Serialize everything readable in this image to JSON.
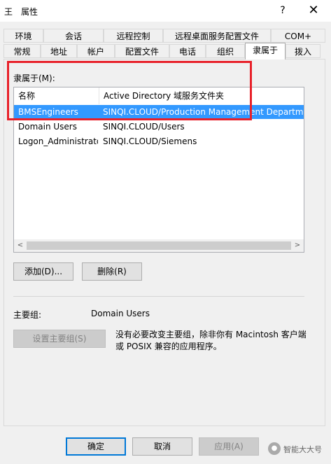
{
  "window": {
    "title": "王　属性",
    "help_glyph": "?",
    "close_glyph": "✕"
  },
  "tabs_row1": [
    "环境",
    "会话",
    "远程控制",
    "远程桌面服务配置文件",
    "COM+"
  ],
  "tabs_row2": [
    "常规",
    "地址",
    "帐户",
    "配置文件",
    "电话",
    "组织",
    "隶属于",
    "拨入"
  ],
  "member_of_label": "隶属于(M):",
  "list": {
    "headers": [
      "名称",
      "Active Directory 域服务文件夹"
    ],
    "rows": [
      {
        "name": "BMSEngineers",
        "folder": "SINQI.CLOUD/Production Management Department",
        "selected": true
      },
      {
        "name": "Domain Users",
        "folder": "SINQI.CLOUD/Users",
        "selected": false
      },
      {
        "name": "Logon_Administrators",
        "folder": "SINQI.CLOUD/Siemens",
        "selected": false
      }
    ]
  },
  "scroll": {
    "left": "<",
    "right": ">"
  },
  "buttons": {
    "add": "添加(D)...",
    "remove": "删除(R)"
  },
  "primary_group": {
    "label": "主要组:",
    "value": "Domain Users"
  },
  "set_primary_button": "设置主要组(S)",
  "note": "没有必要改变主要组，除非你有 Macintosh 客户端或 POSIX 兼容的应用程序。",
  "footer": {
    "ok": "确定",
    "cancel": "取消",
    "apply": "应用(A)"
  },
  "watermark": {
    "text": "智能大大号"
  },
  "colors": {
    "highlight": "#3399ff",
    "annotation_red": "#e8212a",
    "focus_blue": "#0078d7"
  }
}
